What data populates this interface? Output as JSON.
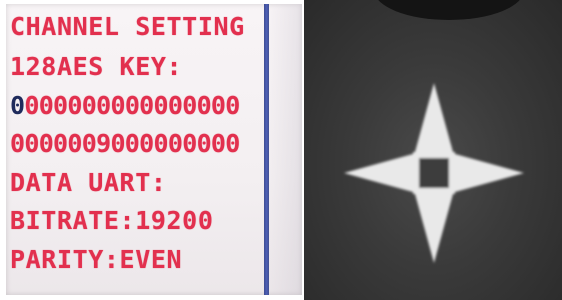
{
  "lcd": {
    "lines": [
      "CHANNEL SETTING",
      "128AES KEY:",
      "000000000000000",
      "0000009000000000",
      "DATA UART:",
      "BITRATE:19200",
      "PARITY:EVEN"
    ],
    "cursor_char": "0",
    "text_color": "#e2304e",
    "background_color": "#f5f1f3"
  },
  "photo": {
    "control": "directional-pad-icon",
    "background_color": "#3a3a3a",
    "button_color": "#e8e8e8"
  }
}
